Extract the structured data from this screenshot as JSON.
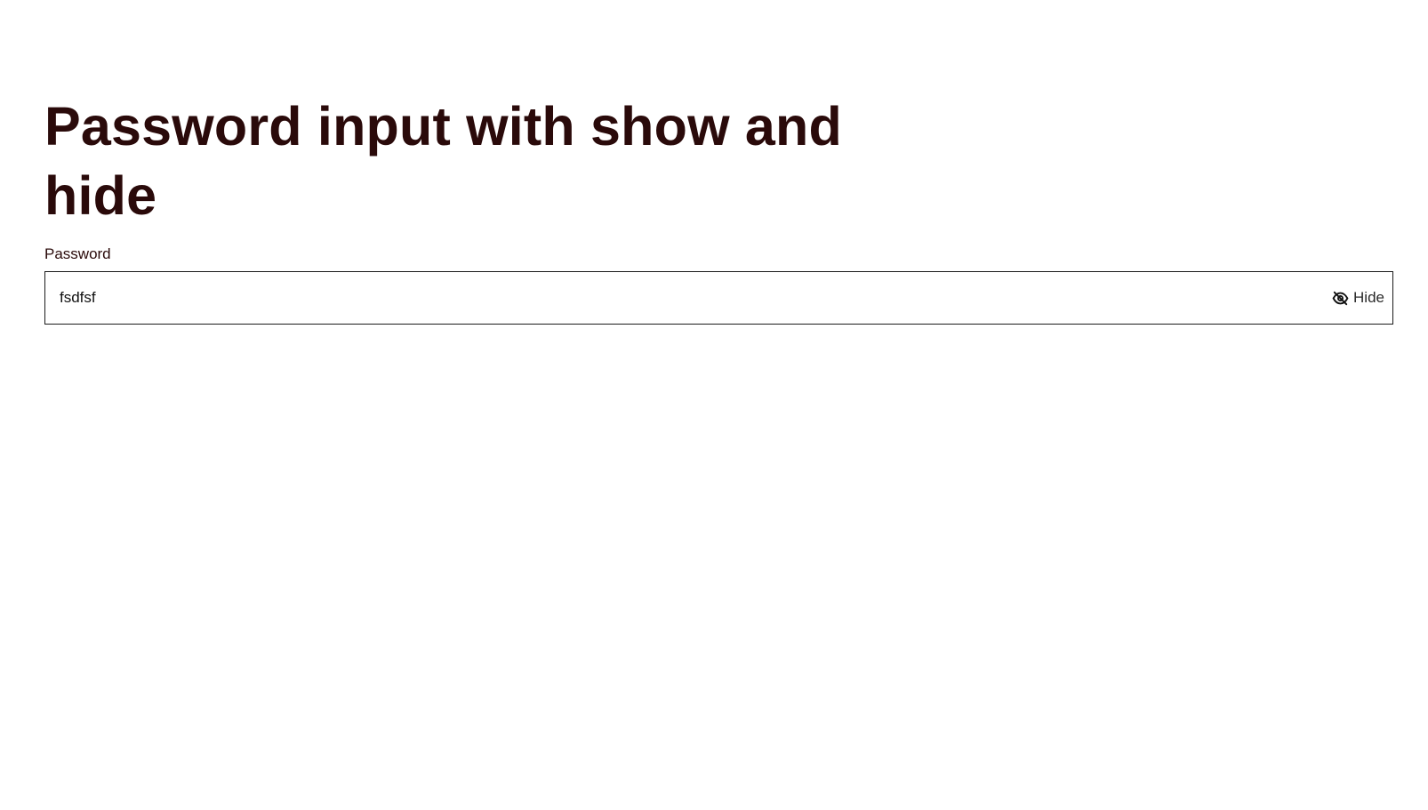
{
  "heading": "Password input with show and hide",
  "password_field": {
    "label": "Password",
    "value": "fsdfsf",
    "toggle": {
      "label": "Hide",
      "icon": "eye-slash-icon"
    }
  },
  "colors": {
    "heading_text": "#2a0a0a",
    "input_border": "#1a1a1a",
    "background": "#ffffff"
  }
}
